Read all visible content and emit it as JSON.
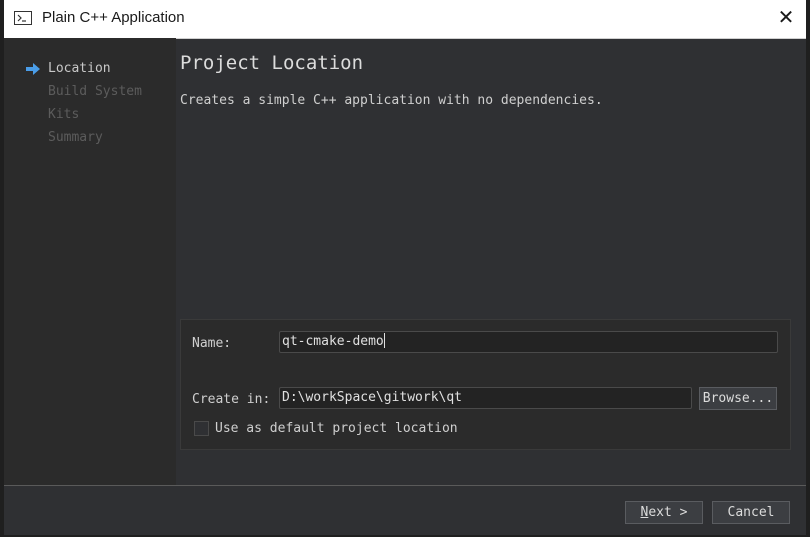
{
  "window": {
    "title": "Plain C++ Application"
  },
  "steps": [
    {
      "label": "Location",
      "state": "current"
    },
    {
      "label": "Build System",
      "state": "pending"
    },
    {
      "label": "Kits",
      "state": "pending"
    },
    {
      "label": "Summary",
      "state": "pending"
    }
  ],
  "page": {
    "heading": "Project Location",
    "description": "Creates a simple C++ application with no dependencies."
  },
  "form": {
    "name_label": "Name:",
    "name_value": "qt-cmake-demo",
    "create_in_label": "Create in:",
    "create_in_value": "D:\\workSpace\\gitwork\\qt",
    "browse_label": "Browse...",
    "default_location_label": "Use as default project location",
    "default_location_checked": false
  },
  "buttons": {
    "next_mnemonic": "N",
    "next_rest": "ext >",
    "cancel_label": "Cancel"
  },
  "colors": {
    "accent_arrow": "#4a9de8",
    "background": "#2f3033"
  }
}
